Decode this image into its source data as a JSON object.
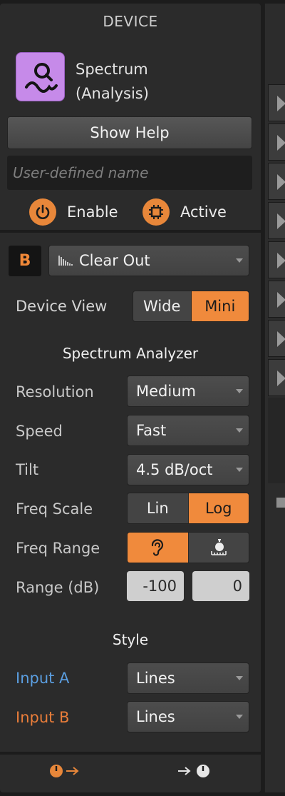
{
  "header": {
    "title": "DEVICE"
  },
  "device": {
    "icon": "spectrum-analysis-icon",
    "icon_color": "#c68ae9",
    "name_line1": "Spectrum",
    "name_line2": "(Analysis)",
    "show_help_label": "Show Help",
    "user_name_placeholder": "User-defined name",
    "user_name_value": "",
    "enable_label": "Enable",
    "active_label": "Active",
    "accent_color": "#e8873a"
  },
  "preset": {
    "badge": "B",
    "name": "Clear Out",
    "icon": "waveform-icon"
  },
  "device_view": {
    "label": "Device View",
    "options": [
      "Wide",
      "Mini"
    ],
    "selected": "Mini"
  },
  "analyzer": {
    "title": "Spectrum Analyzer",
    "resolution": {
      "label": "Resolution",
      "value": "Medium"
    },
    "speed": {
      "label": "Speed",
      "value": "Fast"
    },
    "tilt": {
      "label": "Tilt",
      "value": "4.5 dB/oct"
    },
    "freq_scale": {
      "label": "Freq Scale",
      "options": [
        "Lin",
        "Log"
      ],
      "selected": "Log"
    },
    "freq_range": {
      "label": "Freq Range",
      "options": [
        "ear-icon",
        "custom-range-icon"
      ],
      "selected": "ear-icon"
    },
    "range_db": {
      "label": "Range (dB)",
      "min": "-100",
      "max": "0"
    }
  },
  "style": {
    "title": "Style",
    "input_a": {
      "label": "Input A",
      "value": "Lines",
      "color": "#5b9ee0"
    },
    "input_b": {
      "label": "Input B",
      "value": "Lines",
      "color": "#e97d3a"
    }
  },
  "footer": {
    "left_icon": "input-routing-icon",
    "right_icon": "output-routing-icon"
  }
}
